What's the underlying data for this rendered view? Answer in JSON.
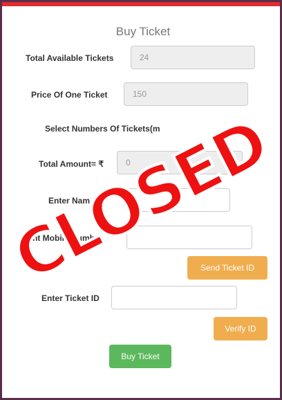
{
  "colors": {
    "accent_top": "#e02d2d",
    "warning_button": "#f0ad4e",
    "success_button": "#5cb85c",
    "stamp": "#ee1111"
  },
  "form": {
    "title": "Buy Ticket",
    "total_available_label": "Total Available Tickets",
    "total_available_value": "24",
    "price_label": "Price Of One Ticket",
    "price_value": "150",
    "select_numbers_label": "Select Numbers Of Tickets(m",
    "total_amount_label": "Total Amount= ₹",
    "total_amount_value": "0",
    "name_label": "Enter Nam",
    "name_value": "",
    "mobile_label": "Ent    Mobile  Number",
    "mobile_value": "",
    "send_ticket_button": "Send Ticket ID",
    "ticket_id_label": "Enter Ticket ID",
    "ticket_id_value": "",
    "verify_button": "Verify ID",
    "buy_button": "Buy Ticket"
  },
  "overlay": {
    "stamp_text": "CLOSED"
  }
}
